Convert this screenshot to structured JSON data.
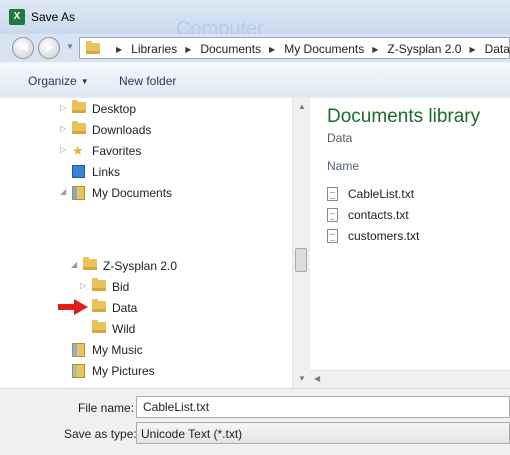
{
  "window": {
    "title": "Save As",
    "app_icon": "excel-icon",
    "ghost_title": "Computer"
  },
  "address": {
    "crumbs": [
      "Libraries",
      "Documents",
      "My Documents",
      "Z-Sysplan 2.0",
      "Data"
    ]
  },
  "toolbar": {
    "organize_label": "Organize",
    "new_folder_label": "New folder"
  },
  "nav": {
    "items": [
      {
        "label": "Desktop",
        "icon": "desktop-folder-icon"
      },
      {
        "label": "Downloads",
        "icon": "downloads-folder-icon"
      },
      {
        "label": "Favorites",
        "icon": "favorites-star-icon"
      },
      {
        "label": "Links",
        "icon": "links-icon"
      },
      {
        "label": "My Documents",
        "icon": "documents-library-icon"
      },
      {
        "label": "Z-Sysplan 2.0",
        "icon": "folder-icon"
      },
      {
        "label": "Bid",
        "icon": "folder-icon"
      },
      {
        "label": "Data",
        "icon": "folder-icon"
      },
      {
        "label": "Wild",
        "icon": "folder-icon"
      },
      {
        "label": "My Music",
        "icon": "music-library-icon"
      },
      {
        "label": "My Pictures",
        "icon": "pictures-library-icon"
      }
    ]
  },
  "content": {
    "library_title": "Documents library",
    "library_subtitle": "Data",
    "column_name": "Name",
    "files": [
      "CableList.txt",
      "contacts.txt",
      "customers.txt"
    ]
  },
  "form": {
    "file_name_label": "File name:",
    "file_name_value": "CableList.txt",
    "save_as_type_label": "Save as type:",
    "save_as_type_value": "Unicode Text (*.txt)"
  },
  "colors": {
    "arrow": "#e01e1e",
    "library_title": "#1e6a2e"
  }
}
